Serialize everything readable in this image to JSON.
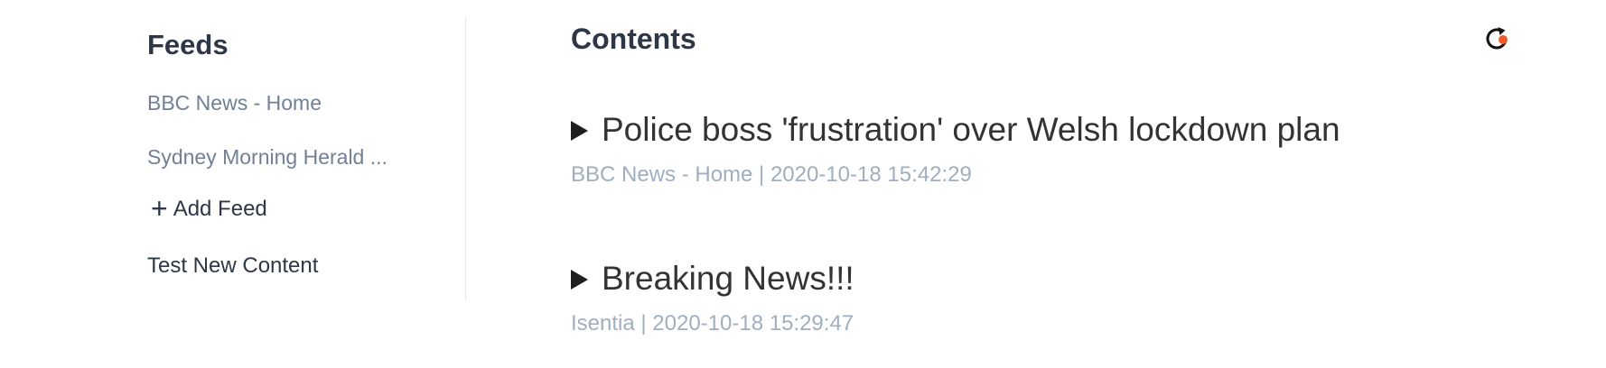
{
  "sidebar": {
    "heading": "Feeds",
    "feeds": [
      {
        "label": "BBC News - Home"
      },
      {
        "label": "Sydney Morning Herald ..."
      }
    ],
    "add_feed": {
      "icon": "plus-icon",
      "label": "Add Feed"
    },
    "test_content": "Test New Content"
  },
  "main": {
    "heading": "Contents",
    "refresh": {
      "icon": "refresh-icon",
      "badge_color": "#f05a28"
    },
    "entries": [
      {
        "title": "Police boss 'frustration' over Welsh lockdown plan",
        "meta": "BBC News - Home | 2020-10-18 15:42:29"
      },
      {
        "title": "Breaking News!!!",
        "meta": "Isentia | 2020-10-18 15:29:47"
      }
    ]
  }
}
